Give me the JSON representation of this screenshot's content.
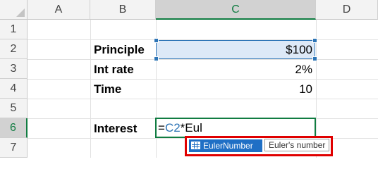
{
  "columns": [
    "A",
    "B",
    "C",
    "D"
  ],
  "rows": [
    "1",
    "2",
    "3",
    "4",
    "5",
    "6",
    "7"
  ],
  "active_column": "C",
  "active_row": "6",
  "cells": {
    "B2": "Principle",
    "C2": "$100",
    "B3": "Int rate",
    "C3": "2%",
    "B4": "Time",
    "C4": "10",
    "B6": "Interest"
  },
  "formula": {
    "prefix": "=",
    "reference": "C2",
    "rest": "*Eul"
  },
  "autocomplete": {
    "item": "EulerNumber",
    "item_icon": "table-icon",
    "tooltip": "Euler's number"
  },
  "colors": {
    "selection_fill": "#dde9f7",
    "selection_border": "#2e75b6",
    "active_green": "#107c41",
    "autocomplete_highlight": "#1f6fc5",
    "annotation_red": "#e00000"
  }
}
